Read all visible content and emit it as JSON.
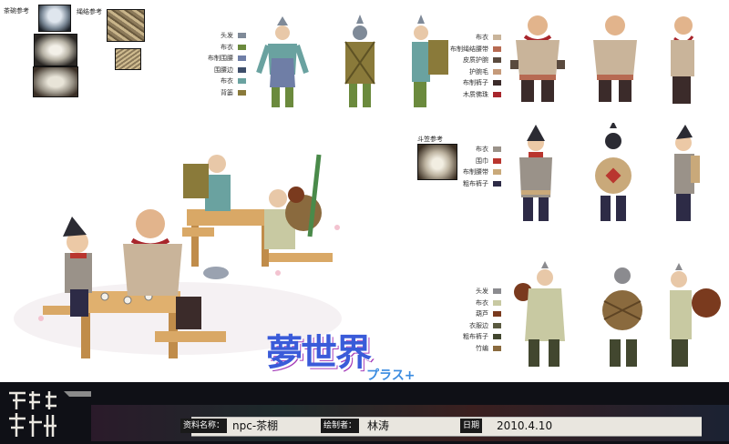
{
  "references": {
    "tea_bowl_label": "茶碗参考",
    "rope_label": "绳结参考",
    "hat_label": "斗笠参考"
  },
  "legends": {
    "set1": [
      {
        "label": "头发",
        "color": "#7f8a98"
      },
      {
        "label": "布衣",
        "color": "#6b8a3d"
      },
      {
        "label": "布制围腰",
        "color": "#6f7ea6"
      },
      {
        "label": "围腰边",
        "color": "#3e4e6a"
      },
      {
        "label": "布衣",
        "color": "#6aa2a0"
      },
      {
        "label": "背篓",
        "color": "#8a7a3a"
      }
    ],
    "set2": [
      {
        "label": "布衣",
        "color": "#c9b49a"
      },
      {
        "label": "布制绳结腰带",
        "color": "#b76a52"
      },
      {
        "label": "皮质护腕",
        "color": "#5a4a3e"
      },
      {
        "label": "护腕毛",
        "color": "#c59a7a"
      },
      {
        "label": "布制裤子",
        "color": "#3b2b2a"
      },
      {
        "label": "木质佛珠",
        "color": "#a8262c"
      }
    ],
    "set3": [
      {
        "label": "布衣",
        "color": "#9a9289"
      },
      {
        "label": "围巾",
        "color": "#b9362f"
      },
      {
        "label": "布制腰带",
        "color": "#c9a97a"
      },
      {
        "label": "粗布裤子",
        "color": "#2d2b46"
      }
    ],
    "set4": [
      {
        "label": "头发",
        "color": "#8b8b8f"
      },
      {
        "label": "布衣",
        "color": "#c8c9a2"
      },
      {
        "label": "葫芦",
        "color": "#7a3a1e"
      },
      {
        "label": "衣服边",
        "color": "#5a5a40"
      },
      {
        "label": "粗布裤子",
        "color": "#42472f"
      },
      {
        "label": "竹编",
        "color": "#8a6a3e"
      }
    ]
  },
  "logo": {
    "main": "夢世界",
    "sub": "プラス+"
  },
  "footer": {
    "name_tag": "资料名称：",
    "name_value": "npc-茶棚",
    "author_tag": "绘制者：",
    "author_value": "林涛",
    "date_tag": "日期",
    "date_value": "2010.4.10"
  },
  "colors": {
    "accent_red": "#c0392b",
    "logo_blue": "#3a5bd9"
  }
}
